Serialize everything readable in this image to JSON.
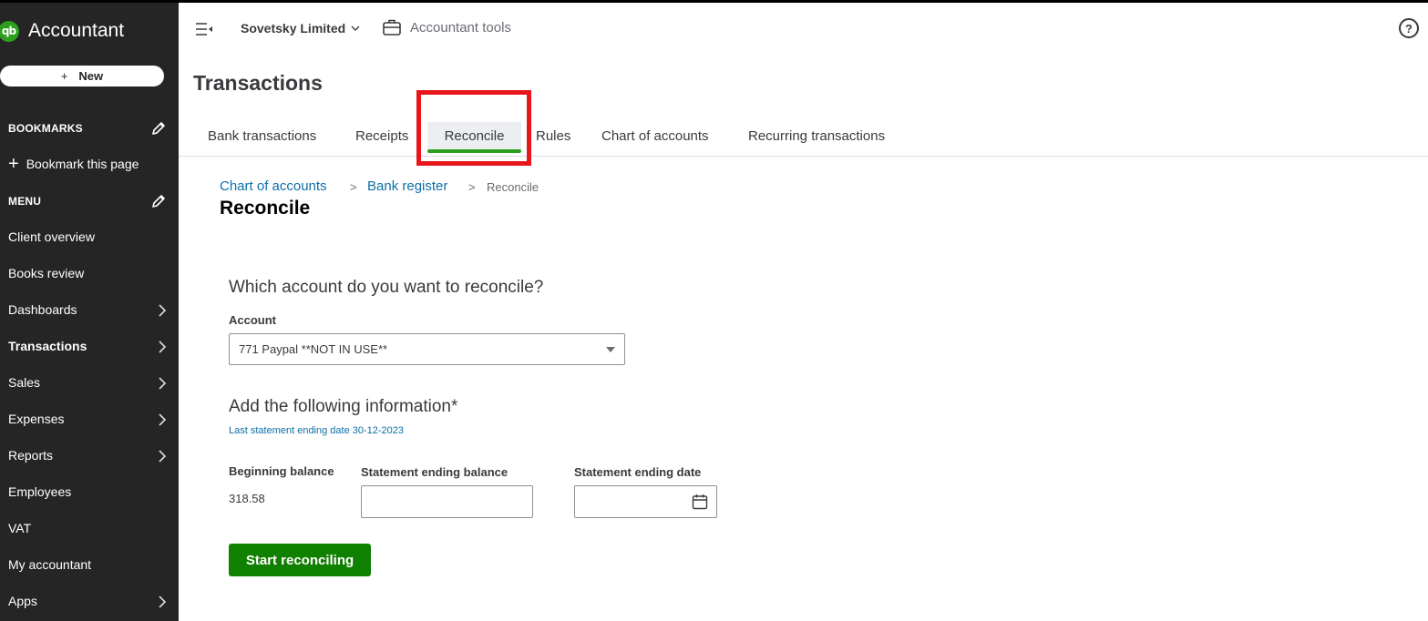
{
  "brand": {
    "name": "Accountant",
    "logo_text": "qb"
  },
  "sidebar": {
    "new_label": "New",
    "bookmarks_heading": "BOOKMARKS",
    "bookmark_this_page": "Bookmark this page",
    "menu_heading": "MENU",
    "items": [
      {
        "label": "Client overview",
        "has_chevron": false,
        "active": false
      },
      {
        "label": "Books review",
        "has_chevron": false,
        "active": false
      },
      {
        "label": "Dashboards",
        "has_chevron": true,
        "active": false
      },
      {
        "label": "Transactions",
        "has_chevron": true,
        "active": true
      },
      {
        "label": "Sales",
        "has_chevron": true,
        "active": false
      },
      {
        "label": "Expenses",
        "has_chevron": true,
        "active": false
      },
      {
        "label": "Reports",
        "has_chevron": true,
        "active": false
      },
      {
        "label": "Employees",
        "has_chevron": false,
        "active": false
      },
      {
        "label": "VAT",
        "has_chevron": false,
        "active": false
      },
      {
        "label": "My accountant",
        "has_chevron": false,
        "active": false
      },
      {
        "label": "Apps",
        "has_chevron": true,
        "active": false
      }
    ]
  },
  "header": {
    "company": "Sovetsky Limited",
    "accountant_tools": "Accountant tools",
    "help": "?"
  },
  "page": {
    "title": "Transactions"
  },
  "tabs": [
    {
      "label": "Bank transactions",
      "active": false
    },
    {
      "label": "Receipts",
      "active": false
    },
    {
      "label": "Reconcile",
      "active": true
    },
    {
      "label": "Rules",
      "active": false
    },
    {
      "label": "Chart of accounts",
      "active": false
    },
    {
      "label": "Recurring transactions",
      "active": false
    }
  ],
  "breadcrumb": {
    "chart_of_accounts": "Chart of accounts",
    "bank_register": "Bank register",
    "separator": ">",
    "current": "Reconcile"
  },
  "reconcile": {
    "title": "Reconcile",
    "question": "Which account do you want to reconcile?",
    "account_label": "Account",
    "account_value": "771 Paypal **NOT IN USE**",
    "add_info": "Add the following information*",
    "last_statement": "Last statement ending date 30-12-2023",
    "beginning_balance_label": "Beginning balance",
    "beginning_balance_value": "318.58",
    "statement_ending_balance_label": "Statement ending balance",
    "statement_ending_balance_value": "",
    "statement_ending_date_label": "Statement ending date",
    "statement_ending_date_value": "",
    "start_button": "Start reconciling"
  },
  "colors": {
    "sidebar_bg": "#252526",
    "brand_green": "#2ca01c",
    "button_green": "#108000",
    "link_blue": "#0d6fa8",
    "highlight_red": "#e8161b"
  }
}
